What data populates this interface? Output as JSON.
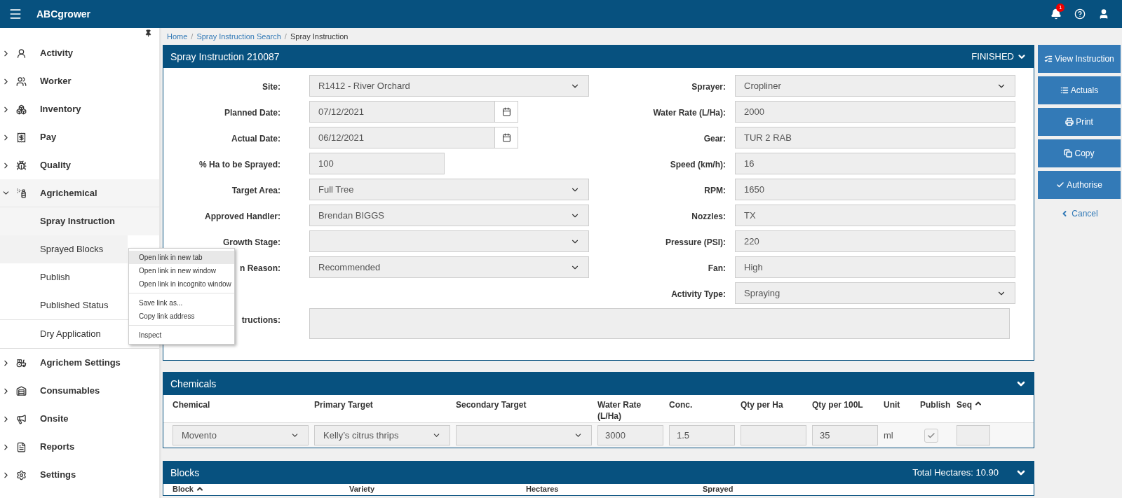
{
  "app": {
    "title": "ABCgrower",
    "notifications": "1"
  },
  "sidebar": {
    "items": [
      {
        "label": "Activity",
        "expanded": false
      },
      {
        "label": "Worker",
        "expanded": false
      },
      {
        "label": "Inventory",
        "expanded": false
      },
      {
        "label": "Pay",
        "expanded": false
      },
      {
        "label": "Quality",
        "expanded": false
      },
      {
        "label": "Agrichemical",
        "expanded": true,
        "children": [
          {
            "label": "Spray Instruction",
            "selected": true,
            "hovered": false,
            "divider_after": false
          },
          {
            "label": "Sprayed Blocks",
            "selected": false,
            "hovered": true,
            "divider_after": false
          },
          {
            "label": "Publish",
            "selected": false,
            "hovered": false,
            "divider_after": false
          },
          {
            "label": "Published Status",
            "selected": false,
            "hovered": false,
            "divider_after": true
          },
          {
            "label": "Dry Application",
            "selected": false,
            "hovered": false,
            "divider_after": true
          }
        ]
      },
      {
        "label": "Agrichem Settings",
        "expanded": false
      },
      {
        "label": "Consumables",
        "expanded": false
      },
      {
        "label": "Onsite",
        "expanded": false
      },
      {
        "label": "Reports",
        "expanded": false
      },
      {
        "label": "Settings",
        "expanded": false
      }
    ]
  },
  "breadcrumb": {
    "separator": "/",
    "items": [
      {
        "label": "Home",
        "link": true
      },
      {
        "label": "Spray Instruction Search",
        "link": true
      },
      {
        "label": "Spray Instruction",
        "link": false
      }
    ]
  },
  "instruction": {
    "title": "Spray Instruction 210087",
    "status": "FINISHED",
    "left_fields": [
      {
        "label": "Site:",
        "kind": "select",
        "value": "R1412 - River Orchard"
      },
      {
        "label": "Planned Date:",
        "kind": "date",
        "value": "07/12/2021"
      },
      {
        "label": "Actual Date:",
        "kind": "date",
        "value": "06/12/2021"
      },
      {
        "label": "% Ha to be Sprayed:",
        "kind": "short",
        "value": "100"
      },
      {
        "label": "Target Area:",
        "kind": "select",
        "value": "Full Tree"
      },
      {
        "label": "Approved Handler:",
        "kind": "select",
        "value": "Brendan BIGGS"
      },
      {
        "label": "Growth Stage:",
        "kind": "select"
      },
      {
        "label": "n Reason:",
        "kind": "select",
        "value": "Recommended"
      },
      {
        "label": "tructions:",
        "kind": "textarea"
      }
    ],
    "right_fields": [
      {
        "label": "Sprayer:",
        "kind": "select",
        "value": "Cropliner"
      },
      {
        "label": "Water Rate (L/Ha):",
        "kind": "text",
        "value": "2000"
      },
      {
        "label": "Gear:",
        "kind": "text",
        "value": "TUR 2 RAB"
      },
      {
        "label": "Speed (km/h):",
        "kind": "text",
        "value": "16"
      },
      {
        "label": "RPM:",
        "kind": "text",
        "value": "1650"
      },
      {
        "label": "Nozzles:",
        "kind": "text",
        "value": "TX"
      },
      {
        "label": "Pressure (PSI):",
        "kind": "text",
        "value": "220"
      },
      {
        "label": "Fan:",
        "kind": "text",
        "value": "High"
      },
      {
        "label": "Activity Type:",
        "kind": "select",
        "value": "Spraying"
      }
    ]
  },
  "actions": [
    {
      "label": "View Instruction"
    },
    {
      "label": "Actuals"
    },
    {
      "label": "Print"
    },
    {
      "label": "Copy"
    },
    {
      "label": "Authorise"
    }
  ],
  "cancel": "Cancel",
  "chemicals": {
    "title": "Chemicals",
    "columns": [
      {
        "label": "Chemical"
      },
      {
        "label": "Primary Target"
      },
      {
        "label": "Secondary Target"
      },
      {
        "label": "Water Rate (L/Ha)"
      },
      {
        "label": "Conc."
      },
      {
        "label": "Qty per Ha"
      },
      {
        "label": "Qty per 100L"
      },
      {
        "label": "Unit"
      },
      {
        "label": "Publish"
      },
      {
        "label": "Seq",
        "sorted": true
      }
    ],
    "rows": [
      [
        {
          "kind": "select",
          "value": "Movento"
        },
        {
          "kind": "select",
          "value": "Kelly’s citrus thrips"
        },
        {
          "kind": "select"
        },
        {
          "kind": "text",
          "value": "3000"
        },
        {
          "kind": "text",
          "value": "1.5"
        },
        {
          "kind": "text"
        },
        {
          "kind": "text",
          "value": "35"
        },
        {
          "kind": "plain",
          "value": "ml"
        },
        {
          "kind": "checkbox",
          "checked": true
        },
        {
          "kind": "text"
        }
      ]
    ]
  },
  "blocks": {
    "title": "Blocks",
    "total": "Total Hectares: 10.90",
    "columns": [
      {
        "label": "Block",
        "sorted": true
      },
      {
        "label": "Variety"
      },
      {
        "label": "Hectares"
      },
      {
        "label": "Sprayed"
      }
    ]
  },
  "context_menu": {
    "groups": [
      [
        {
          "label": "Open link in new tab",
          "hovered": true
        },
        {
          "label": "Open link in new window",
          "hovered": false
        },
        {
          "label": "Open link in incognito window",
          "hovered": false
        }
      ],
      [
        {
          "label": "Save link as...",
          "hovered": false
        },
        {
          "label": "Copy link address",
          "hovered": false
        }
      ],
      [
        {
          "label": "Inspect",
          "hovered": false
        }
      ]
    ]
  }
}
